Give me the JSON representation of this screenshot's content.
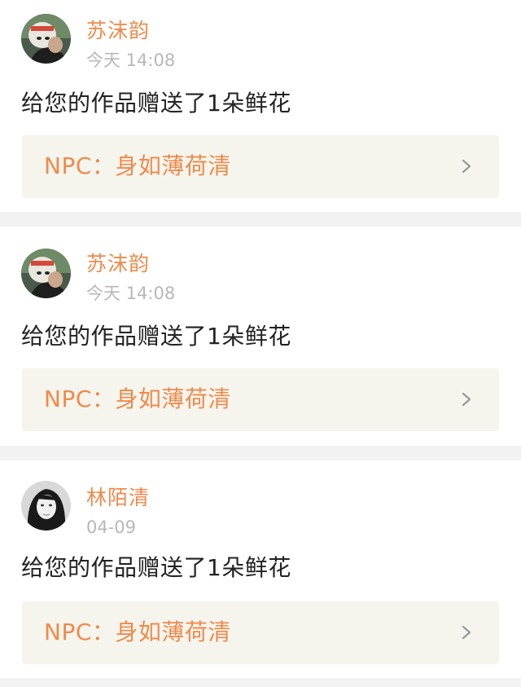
{
  "notifications": [
    {
      "user_name": "苏沫韵",
      "time": "今天 14:08",
      "message": "给您的作品赠送了1朵鲜花",
      "work_label": "NPC：身如薄荷清",
      "avatar": "cartoon-avatar-icon",
      "chevron": "chevron-right-icon"
    },
    {
      "user_name": "苏沫韵",
      "time": "今天 14:08",
      "message": "给您的作品赠送了1朵鲜花",
      "work_label": "NPC：身如薄荷清",
      "avatar": "cartoon-avatar-icon",
      "chevron": "chevron-right-icon"
    },
    {
      "user_name": "林陌清",
      "time": "04-09",
      "message": "给您的作品赠送了1朵鲜花",
      "work_label": "NPC：身如薄荷清",
      "avatar": "portrait-avatar-icon",
      "chevron": "chevron-right-icon"
    }
  ],
  "colors": {
    "accent": "#f08a4b",
    "background": "#f2f2f2",
    "card": "#ffffff",
    "link_box": "#f5f5ee",
    "muted_text": "#b8b8b8",
    "body_text": "#222222"
  }
}
